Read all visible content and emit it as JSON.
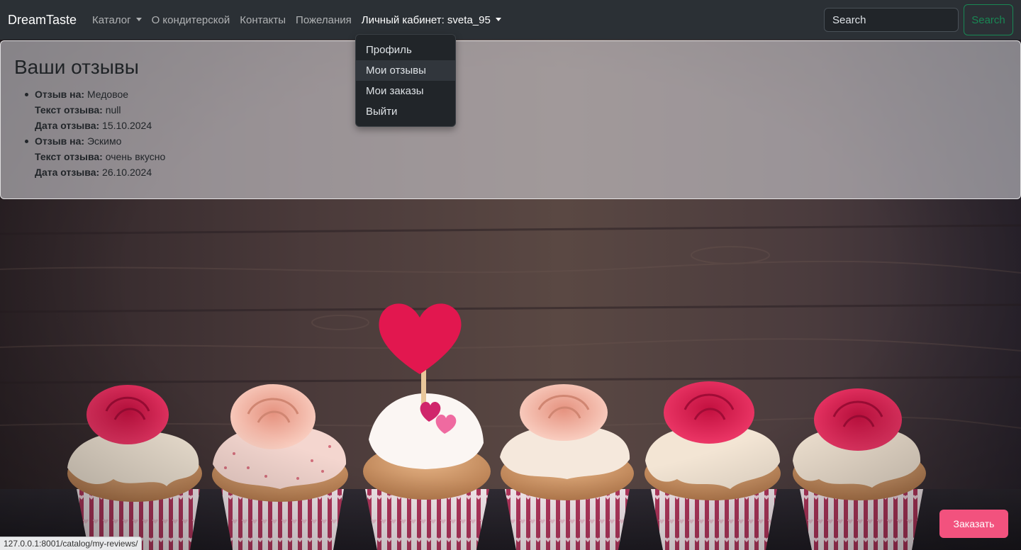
{
  "navbar": {
    "brand": "DreamTaste",
    "links": {
      "catalog": "Каталог",
      "about": "О кондитерской",
      "contacts": "Контакты",
      "wishes": "Пожелания",
      "account": "Личный кабинет: sveta_95"
    },
    "search": {
      "placeholder": "Search",
      "button_label": "Search"
    }
  },
  "account_dropdown": {
    "items": {
      "profile": "Профиль",
      "my_reviews": "Мои отзывы",
      "my_orders": "Мои заказы",
      "logout": "Выйти"
    }
  },
  "reviews": {
    "title": "Ваши отзывы",
    "labels": {
      "review_for": "Отзыв на:",
      "review_text": "Текст отзыва:",
      "review_date": "Дата отзыва:"
    },
    "items": [
      {
        "product": "Медовое",
        "text": "null",
        "date": "15.10.2024"
      },
      {
        "product": "Эскимо",
        "text": "очень вкусно",
        "date": "26.10.2024"
      }
    ]
  },
  "order_button": {
    "label": "Заказать"
  },
  "status_bar": {
    "url": "127.0.0.1:8001/catalog/my-reviews/"
  },
  "colors": {
    "navbar_bg": "#2b3035",
    "search_button": "#198754",
    "order_button": "#f2527e"
  }
}
